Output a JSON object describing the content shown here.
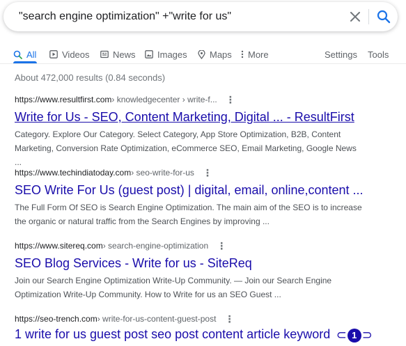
{
  "search": {
    "query": "\"search engine optimization\" +\"write for us\""
  },
  "tabs": [
    {
      "label": "All",
      "icon": "search-icon"
    },
    {
      "label": "Videos",
      "icon": "video-icon"
    },
    {
      "label": "News",
      "icon": "news-icon"
    },
    {
      "label": "Images",
      "icon": "image-icon"
    },
    {
      "label": "Maps",
      "icon": "map-pin-icon"
    },
    {
      "label": "More",
      "icon": "more-vert-icon"
    }
  ],
  "tools": {
    "settings": "Settings",
    "tools": "Tools"
  },
  "stats": "About 472,000 results (0.84 seconds)",
  "results": [
    {
      "domain": "https://www.resultfirst.com",
      "crumb": " › knowledgecenter › write-f...",
      "title": "Write for Us - SEO, Content Marketing, Digital ... - ResultFirst",
      "snippet": "Category. Explore Our Category. Select Category, App Store Optimization, B2B, Content Marketing, Conversion Rate Optimization, eCommerce SEO, Email Marketing, Google News ..."
    },
    {
      "domain": "https://www.techindiatoday.com",
      "crumb": " › seo-write-for-us",
      "title": "SEO Write For Us (guest post) | digital, email, online,content ...",
      "snippet": "The Full Form Of SEO is Search Engine Optimization. The main aim of the SEO is to increase the organic or natural traffic from the Search Engines by improving ..."
    },
    {
      "domain": "https://www.sitereq.com",
      "crumb": " › search-engine-optimization",
      "title": "SEO Blog Services - Write for us - SiteReq",
      "snippet": "Join our Search Engine Optimization Write-Up Community. — Join our Search Engine Optimization Write-Up Community. How to Write for us an SEO Guest ..."
    },
    {
      "domain": "https://seo-trench.com",
      "crumb": " › write-for-us-content-guest-post",
      "title": "1 write for us guest post seo post content article keyword",
      "badge_number": "1"
    }
  ],
  "colors": {
    "accent": "#1a73e8",
    "link": "#1a0dab",
    "muted": "#5f6368"
  }
}
